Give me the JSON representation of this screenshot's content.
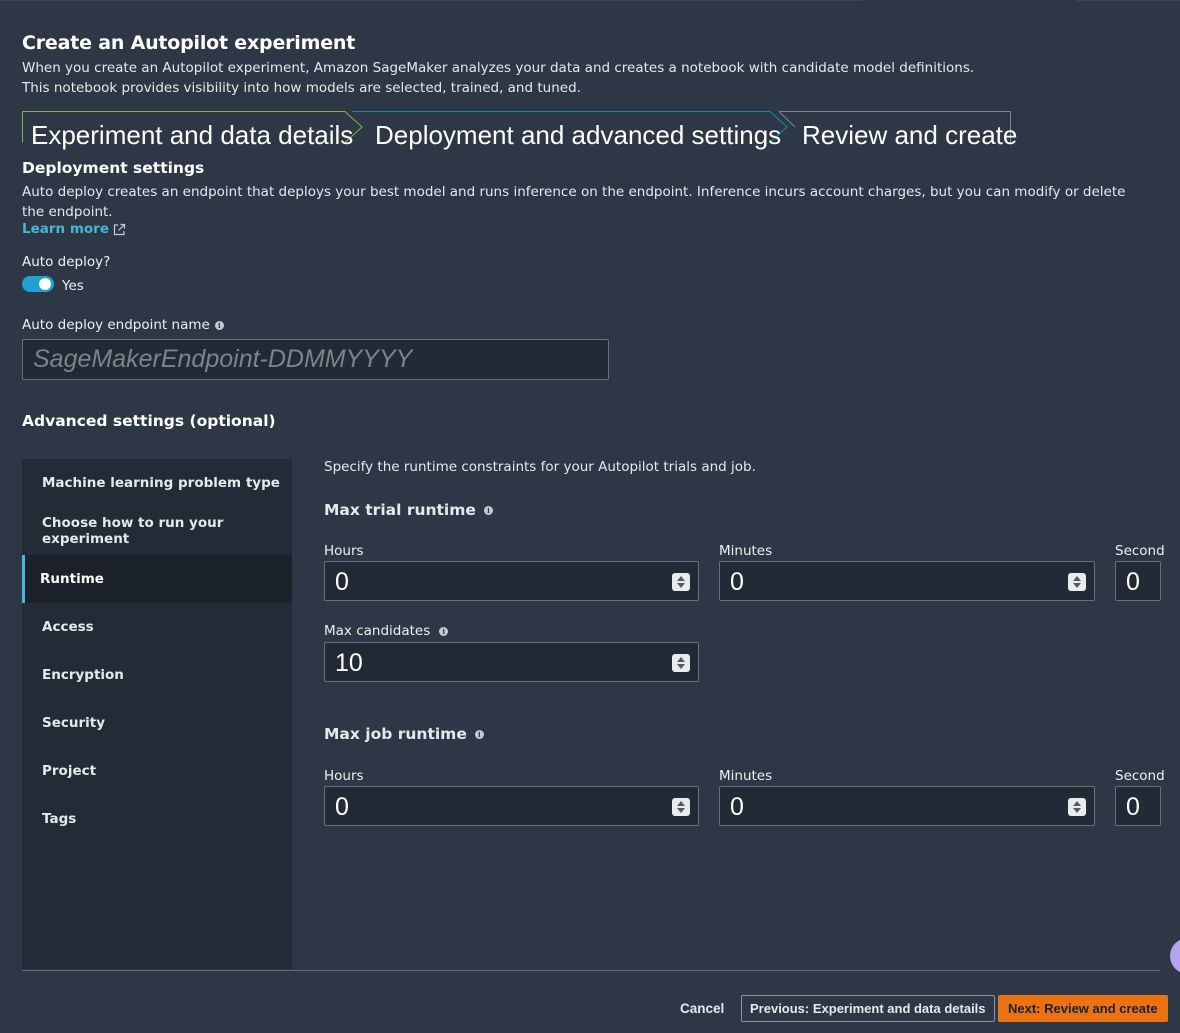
{
  "page": {
    "title": "Create an Autopilot experiment",
    "description_line1": "When you create an Autopilot experiment, Amazon SageMaker analyzes your data and creates a notebook with candidate model definitions.",
    "description_line2": "This notebook provides visibility into how models are selected, trained, and tuned."
  },
  "steps": [
    {
      "label": "Experiment and data details",
      "state": "completed",
      "color": "#7db645"
    },
    {
      "label": "Deployment and advanced settings",
      "state": "current",
      "color": "#0f8fae"
    },
    {
      "label": "Review and create",
      "state": "upcoming",
      "color": "#7d8691"
    }
  ],
  "deployment": {
    "title": "Deployment settings",
    "description": "Auto deploy creates an endpoint that deploys your best model and runs inference on the endpoint. Inference incurs account charges, but you can modify or delete the endpoint.",
    "learn_more": "Learn more",
    "auto_deploy_label": "Auto deploy?",
    "auto_deploy_value": "Yes",
    "endpoint_label": "Auto deploy endpoint name",
    "endpoint_placeholder": "SageMakerEndpoint-DDMMYYYY"
  },
  "advanced": {
    "title": "Advanced settings (optional)",
    "nav": [
      {
        "label": "Machine learning problem type",
        "active": false
      },
      {
        "label": "Choose how to run your experiment",
        "active": false
      },
      {
        "label": "Runtime",
        "active": true
      },
      {
        "label": "Access",
        "active": false
      },
      {
        "label": "Encryption",
        "active": false
      },
      {
        "label": "Security",
        "active": false
      },
      {
        "label": "Project",
        "active": false
      },
      {
        "label": "Tags",
        "active": false
      }
    ],
    "runtime": {
      "description": "Specify the runtime constraints for your Autopilot trials and job.",
      "max_trial": {
        "title": "Max trial runtime",
        "hours_label": "Hours",
        "hours_value": "0",
        "minutes_label": "Minutes",
        "minutes_value": "0",
        "seconds_label": "Second",
        "seconds_value": "0"
      },
      "max_candidates": {
        "label": "Max candidates",
        "value": "10"
      },
      "max_job": {
        "title": "Max job runtime",
        "hours_label": "Hours",
        "hours_value": "0",
        "minutes_label": "Minutes",
        "minutes_value": "0",
        "seconds_label": "Second",
        "seconds_value": "0"
      }
    }
  },
  "footer": {
    "cancel": "Cancel",
    "previous": "Previous: Experiment and data details",
    "next": "Next: Review and create"
  },
  "colors": {
    "accent": "#44b9d6",
    "primary_button": "#ec7211",
    "toggle_on": "#1fa1d4"
  }
}
